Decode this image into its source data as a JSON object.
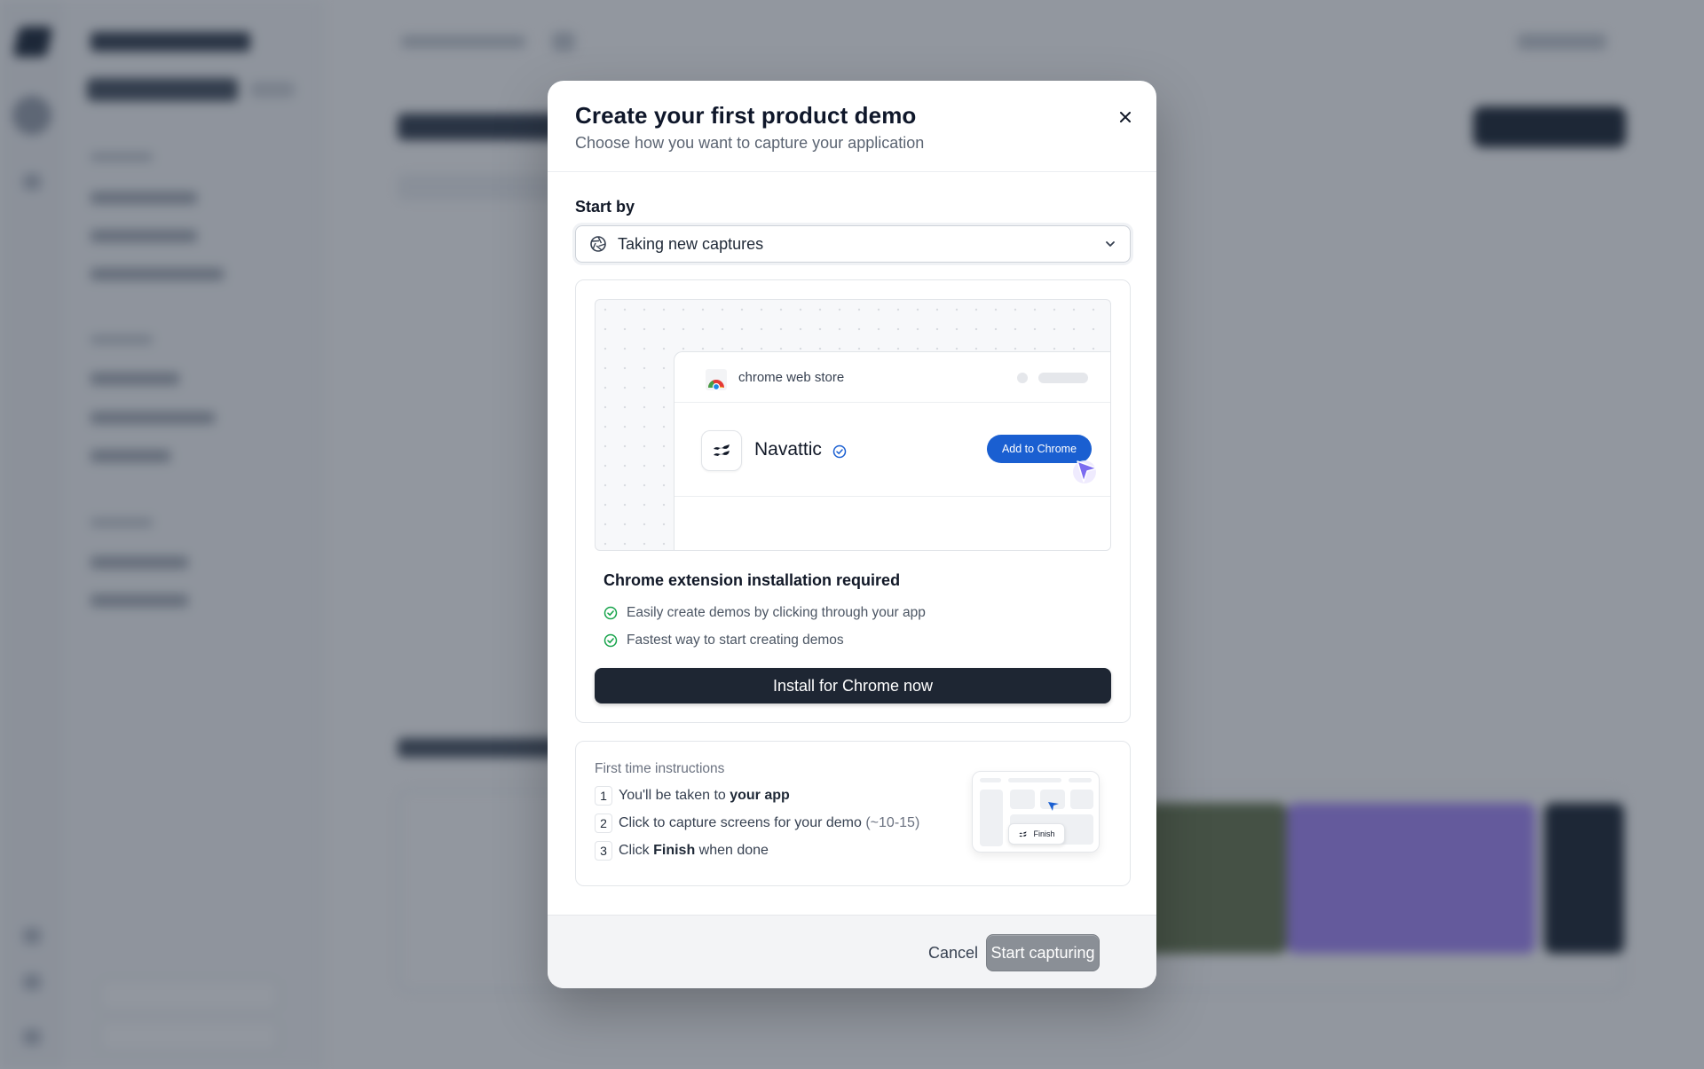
{
  "modal": {
    "title": "Create your first product demo",
    "subtitle": "Choose how you want to capture your application",
    "start_by_label": "Start by",
    "select_value": "Taking new captures",
    "preview": {
      "store_name": "chrome web store",
      "extension_name": "Navattic",
      "add_button": "Add to Chrome"
    },
    "requirement_title": "Chrome extension installation required",
    "benefits": [
      "Easily create demos by clicking through your app",
      "Fastest way to start creating demos"
    ],
    "install_button": "Install for Chrome now",
    "instructions": {
      "title": "First time instructions",
      "steps": [
        {
          "num": "1",
          "text": "You'll be taken to ",
          "bold": "your app",
          "suffix": ""
        },
        {
          "num": "2",
          "text": "Click to capture screens for your demo ",
          "bold": "",
          "suffix": "(~10-15)"
        },
        {
          "num": "3",
          "text": "Click ",
          "bold": "Finish",
          "suffix": " when done"
        }
      ],
      "mini_finish": "Finish"
    },
    "cancel_button": "Cancel",
    "start_button": "Start capturing"
  },
  "colors": {
    "primary_dark": "#1e2633",
    "accent_blue": "#1a5fd1",
    "success_green": "#16a34a",
    "disabled_button": "#8a8f96"
  },
  "icons": [
    "close-icon",
    "aperture-icon",
    "chevron-down-icon",
    "chrome-logo-icon",
    "navattic-logo-icon",
    "verified-badge-icon",
    "cursor-pointer-icon",
    "check-circle-icon"
  ]
}
